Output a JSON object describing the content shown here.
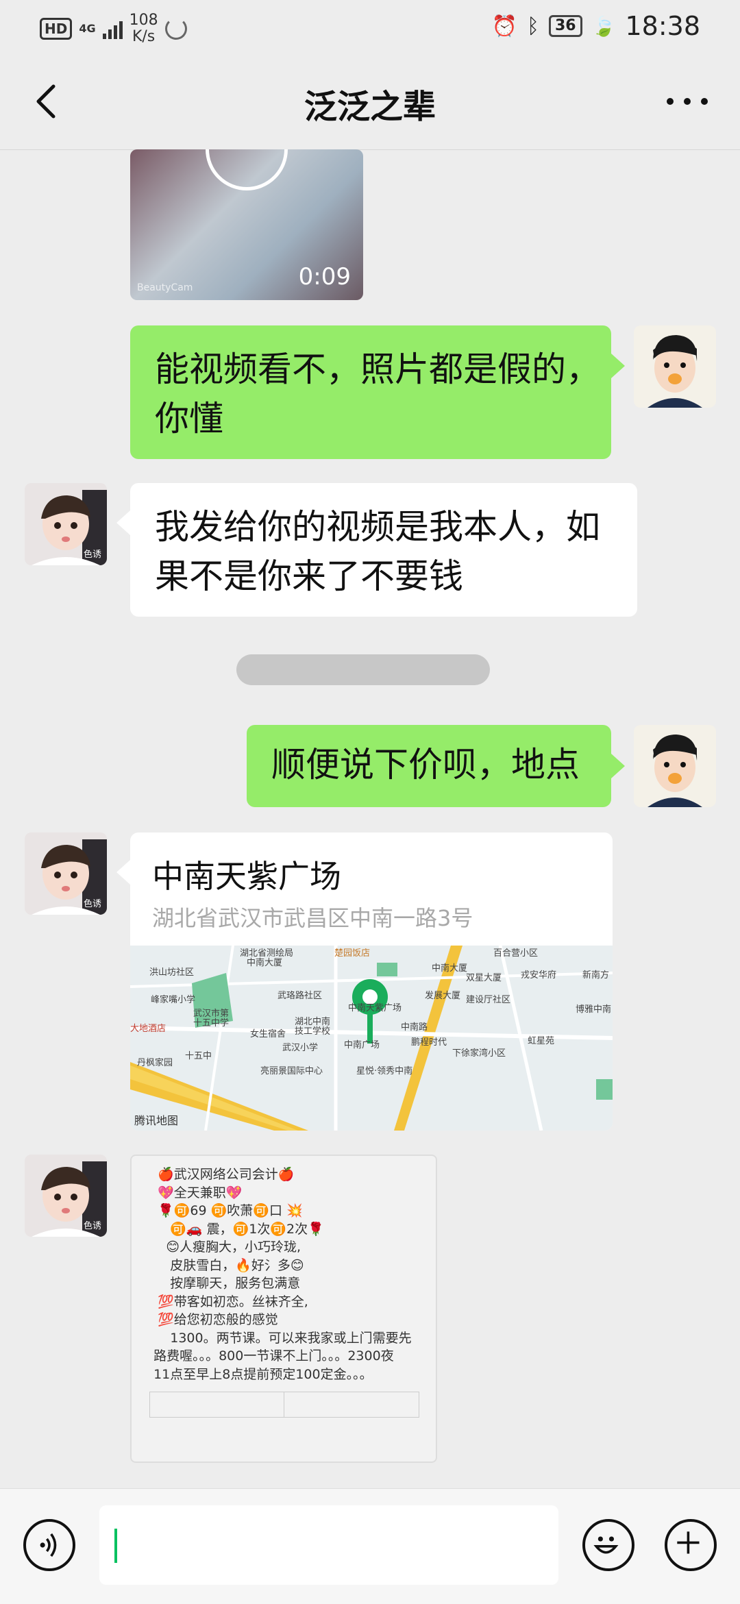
{
  "status_bar": {
    "hd": "HD",
    "network": "4G",
    "speed": "108\nK/s",
    "battery": "36",
    "time": "18:38"
  },
  "nav": {
    "title": "泛泛之辈"
  },
  "video_msg": {
    "duration": "0:09",
    "watermark": "BeautyCam"
  },
  "messages": [
    {
      "side": "right",
      "text": "能视频看不，照片都是假的，\n你懂"
    },
    {
      "side": "left",
      "text": "我发给你的视频是我本人，如\n果不是你来了不要钱"
    },
    {
      "side": "right",
      "text": "顺便说下价呗，地点"
    }
  ],
  "avatar_label": "色诱",
  "location": {
    "name": "中南天紫广场",
    "address": "湖北省武汉市武昌区中南一路3号",
    "provider": "腾讯地图",
    "labels": [
      "洪山坊社区",
      "湖北省测绘局",
      "中南大厦",
      "楚园饭店",
      "百合营小区",
      "中南大厦",
      "双星大厦",
      "戎安华府",
      "新南方",
      "峰家嘴小学",
      "武珞路社区",
      "武汉市第",
      "十五中学",
      "发展大厦",
      "建设厅社区",
      "博雅中南",
      "大地酒店",
      "湖北中南",
      "技工学校",
      "中南天紫广场",
      "中南路",
      "女生宿舍",
      "武汉小学",
      "中南广场",
      "鹏程时代",
      "虹星苑",
      "十五中",
      "下徐家湾小区",
      "丹枫家园",
      "亮丽景国际中心",
      "星悦·领秀中南"
    ]
  },
  "promo": {
    "lines": [
      "   🍎武汉网络公司会计🍎",
      "   💖全天兼职💖",
      "   🌹🉑69 🉑吹萧🉑口 💥",
      "      🉑🚗 震，🉑1次🉑2次🌹",
      "     😊人瘦胸大，小巧玲珑,",
      "      皮肤雪白，🔥好氵多😊",
      "      按摩聊天，服务包满意",
      "   💯带客如初恋。丝袜齐全,",
      "   💯给您初恋般的感觉",
      "      1300。两节课。可以来我家或上门需要先",
      "  路费喔。。。800一节课不上门。。。2300夜",
      "  11点至早上8点提前预定100定金。。。"
    ]
  }
}
